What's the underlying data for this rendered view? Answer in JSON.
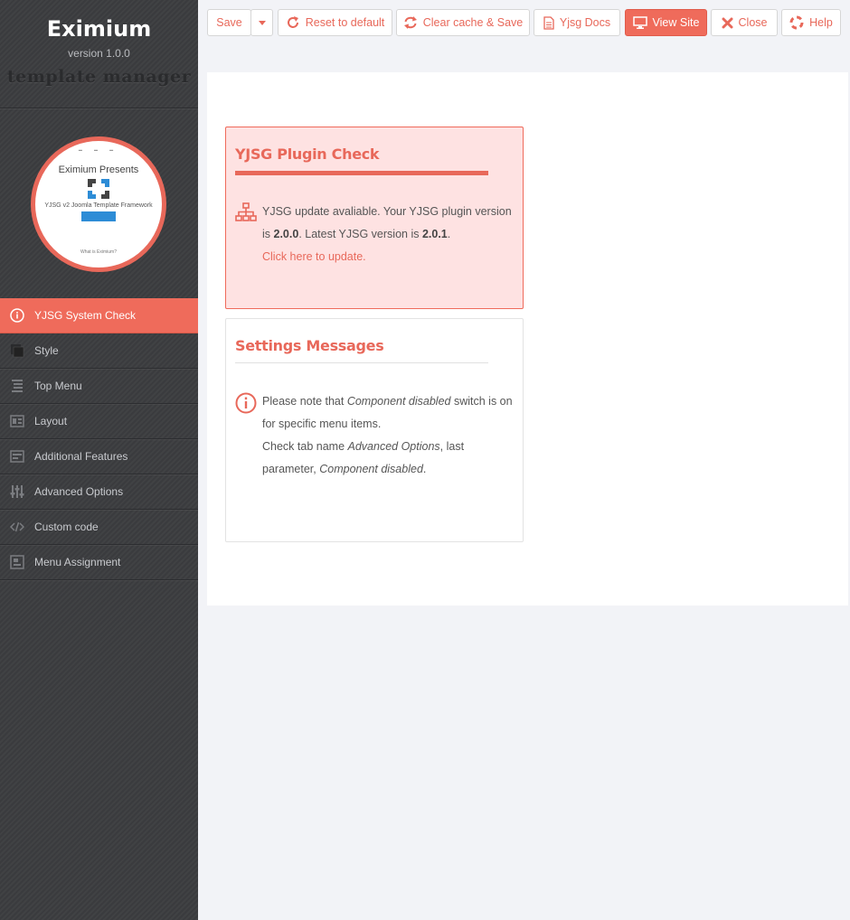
{
  "brand": {
    "title": "Eximium",
    "version": "version 1.0.0",
    "subtitle": "template manager"
  },
  "preview": {
    "nav_text": "",
    "headline": "Eximium Presents",
    "caption": "YJSG v2 Joomla Template Framework",
    "button_text": "",
    "footer": "What is Eximium?"
  },
  "sidebar": {
    "items": [
      {
        "label": "YJSG System Check",
        "icon": "info-icon",
        "active": true
      },
      {
        "label": "Style",
        "icon": "style-icon"
      },
      {
        "label": "Top Menu",
        "icon": "menu-list-icon"
      },
      {
        "label": "Layout",
        "icon": "layout-icon"
      },
      {
        "label": "Additional Features",
        "icon": "features-icon"
      },
      {
        "label": "Advanced Options",
        "icon": "sliders-icon"
      },
      {
        "label": "Custom code",
        "icon": "code-icon"
      },
      {
        "label": "Menu Assignment",
        "icon": "assignment-icon"
      }
    ]
  },
  "toolbar": {
    "save": "Save",
    "reset": "Reset to default",
    "clear_cache": "Clear cache & Save",
    "docs": "Yjsg Docs",
    "view_site": "View Site",
    "close": "Close",
    "help": "Help"
  },
  "plugin_check": {
    "title": "YJSG Plugin Check",
    "text_1": "YJSG update avaliable. Your YJSG plugin version is ",
    "current_version": "2.0.0",
    "text_2": ". Latest YJSG version is ",
    "latest_version": "2.0.1",
    "text_3": ".",
    "update_link": "Click here to update."
  },
  "settings_messages": {
    "title": "Settings Messages",
    "p1_a": "Please note that ",
    "p1_em": "Component disabled",
    "p1_b": " switch is on for specific menu items.",
    "p2_a": "Check tab name ",
    "p2_em1": "Advanced Options",
    "p2_b": ", last parameter, ",
    "p2_em2": "Component disabled",
    "p2_c": "."
  },
  "colors": {
    "accent": "#ef6b5b",
    "sidebar_bg": "#3c3d40",
    "alert_bg": "#fee2e2"
  }
}
